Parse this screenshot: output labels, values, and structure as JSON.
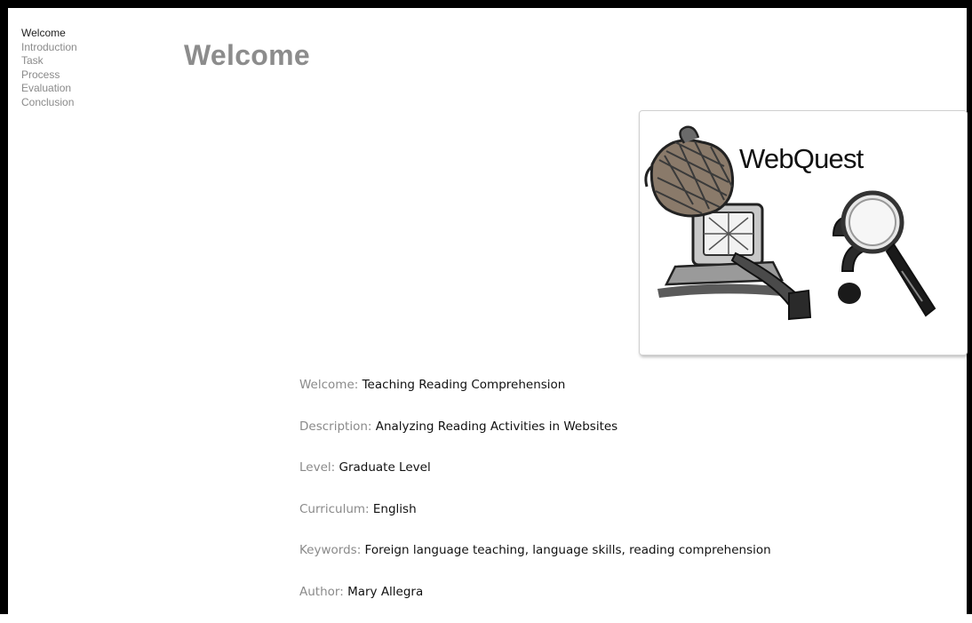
{
  "nav": {
    "items": [
      {
        "label": "Welcome",
        "active": true
      },
      {
        "label": "Introduction",
        "active": false
      },
      {
        "label": "Task",
        "active": false
      },
      {
        "label": "Process",
        "active": false
      },
      {
        "label": "Evaluation",
        "active": false
      },
      {
        "label": "Conclusion",
        "active": false
      }
    ]
  },
  "main": {
    "title": "Welcome",
    "logo": {
      "text": "WebQuest",
      "icons": [
        "detective-hat-icon",
        "computer-icon",
        "pipe-icon",
        "magnifying-glass-icon",
        "question-mark-icon"
      ]
    },
    "info": [
      {
        "label": "Welcome:",
        "value": "Teaching Reading Comprehension"
      },
      {
        "label": "Description:",
        "value": "Analyzing Reading Activities in Websites"
      },
      {
        "label": "Level:",
        "value": "Graduate Level"
      },
      {
        "label": "Curriculum:",
        "value": "English"
      },
      {
        "label": "Keywords:",
        "value": "Foreign language teaching, language skills, reading comprehension"
      },
      {
        "label": "Author:",
        "value": "Mary Allegra"
      }
    ]
  },
  "colors": {
    "frame": "#000000",
    "nav_active": "#222222",
    "nav_inactive": "#8a8a8a",
    "title": "#8c8c8c",
    "label": "#8a8a8a",
    "value": "#111111"
  }
}
